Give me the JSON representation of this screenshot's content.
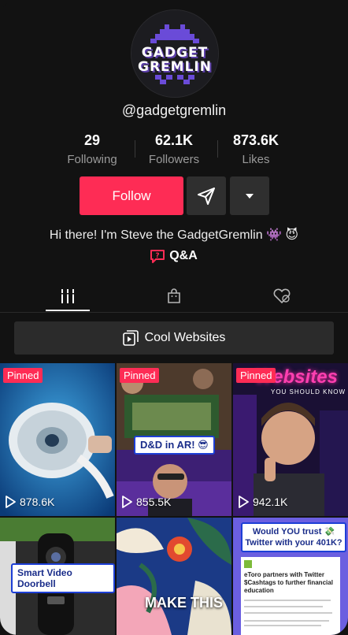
{
  "profile": {
    "logo_line1": "GADGET",
    "logo_line2": "GREMLIN",
    "handle": "@gadgetgremlin",
    "bio": "Hi there! I'm Steve the GadgetGremlin 👾 😈",
    "qa_label": "Q&A"
  },
  "stats": [
    {
      "value": "29",
      "label": "Following"
    },
    {
      "value": "62.1K",
      "label": "Followers"
    },
    {
      "value": "873.6K",
      "label": "Likes"
    }
  ],
  "actions": {
    "follow_label": "Follow"
  },
  "tabs": [
    {
      "icon": "videos-grid-icon",
      "active": true
    },
    {
      "icon": "shopping-bag-icon",
      "active": false
    },
    {
      "icon": "liked-hidden-icon",
      "active": false
    }
  ],
  "playlist": {
    "label": "Cool Websites"
  },
  "videos": [
    {
      "pinned": "Pinned",
      "views": "878.6K"
    },
    {
      "pinned": "Pinned",
      "views": "855.5K",
      "caption": "D&D in AR! 😎"
    },
    {
      "pinned": "Pinned",
      "views": "942.1K",
      "title_overlay": "Websites",
      "subtitle_overlay": "YOU SHOULD KNOW"
    },
    {
      "caption": "Smart Video Doorbell"
    },
    {
      "caption": "MAKE THIS"
    },
    {
      "caption_line1": "Would YOU trust 💸",
      "caption_line2": "Twitter with your 401K?",
      "article_title": "eToro partners with Twitter $Cashtags to further financial education"
    }
  ],
  "colors": {
    "accent": "#fe2c55",
    "background": "#121212"
  }
}
